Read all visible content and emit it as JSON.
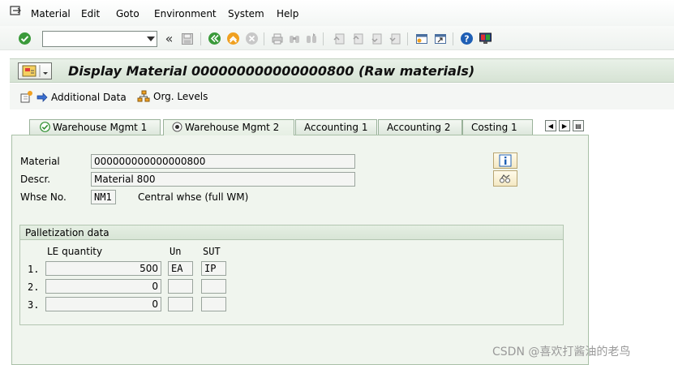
{
  "menu": {
    "items": [
      {
        "key": "M",
        "rest": "aterial"
      },
      {
        "key": "E",
        "rest": "dit"
      },
      {
        "key": "G",
        "rest": "oto"
      },
      {
        "key": "En",
        "rest": "vironment",
        "split": 1
      },
      {
        "key": "S",
        "rest": "ystem"
      },
      {
        "key": "H",
        "rest": "elp"
      }
    ],
    "labels": [
      "Material",
      "Edit",
      "Goto",
      "Environment",
      "System",
      "Help"
    ]
  },
  "toolbar": {
    "command_value": "",
    "collapse_glyph": "«"
  },
  "title": {
    "text": "Display Material 000000000000000800 (Raw materials)"
  },
  "app_toolbar": {
    "additional_data": "Additional Data",
    "org_levels": "Org. Levels"
  },
  "tabs": [
    {
      "label": "Warehouse Mgmt 1",
      "icon": "check-icon",
      "active": false
    },
    {
      "label": "Warehouse Mgmt 2",
      "icon": "radio-icon",
      "active": true
    },
    {
      "label": "Accounting 1",
      "active": false
    },
    {
      "label": "Accounting 2",
      "active": false
    },
    {
      "label": "Costing 1",
      "active": false
    }
  ],
  "header_fields": {
    "material_label": "Material",
    "material_value": "000000000000000800",
    "descr_label": "Descr.",
    "descr_value": "Material 800",
    "whse_label": "Whse No.",
    "whse_value": "NM1",
    "whse_desc": "Central whse (full WM)"
  },
  "palletization": {
    "title": "Palletization data",
    "col_qty": "LE quantity",
    "col_un": "Un",
    "col_sut": "SUT",
    "rows": [
      {
        "idx": "1.",
        "qty": "500",
        "un": "EA",
        "sut": "IP"
      },
      {
        "idx": "2.",
        "qty": "0",
        "un": "",
        "sut": ""
      },
      {
        "idx": "3.",
        "qty": "0",
        "un": "",
        "sut": ""
      }
    ]
  },
  "watermark": "CSDN @喜欢打酱油的老鸟",
  "colors": {
    "sap_green": "#2f8f2f",
    "accent_orange": "#e08a1e",
    "help_blue": "#1e5fb5"
  }
}
